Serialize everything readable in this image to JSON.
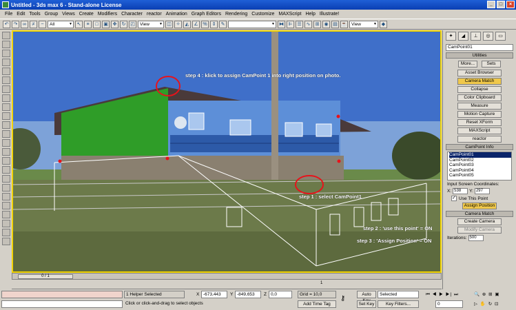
{
  "window": {
    "title": "Untitled - 3ds max 6 - Stand-alone License"
  },
  "menu": [
    "File",
    "Edit",
    "Tools",
    "Group",
    "Views",
    "Create",
    "Modifiers",
    "Character",
    "reactor",
    "Animation",
    "Graph Editors",
    "Rendering",
    "Customize",
    "MAXScript",
    "Help",
    "Illustrate!"
  ],
  "toolbar": {
    "selection_filter": "All",
    "ref_coord": "View",
    "named_selection": "",
    "view_dropdown": "View"
  },
  "viewport": {
    "annotations": {
      "step4": "step 4 : klick to assign CamPoint 1 into right position on photo.",
      "step1": "step 1 : select CamPoint1",
      "step2": "step 2 : 'use this point' = ON",
      "step3": "step 3 : 'Assign Position' = ON"
    },
    "highlight_color": "#e8121a",
    "viewport_border_color": "#f2d400"
  },
  "right_panel": {
    "object_name": "CamPoint01",
    "utilities": {
      "title": "Utilities",
      "more": "More...",
      "sets": "Sets",
      "buttons": [
        "Asset Browser",
        "Camera Match",
        "Collapse",
        "Color Clipboard",
        "Measure",
        "Motion Capture",
        "Reset XForm",
        "MAXScript",
        "reactor"
      ],
      "active_button": "Camera Match"
    },
    "campoint_info": {
      "title": "CamPoint Info",
      "points": [
        "CamPoint01",
        "CamPoint02",
        "CamPoint03",
        "CamPoint04",
        "CamPoint05"
      ],
      "selected": "CamPoint01",
      "coords_label": "Input Screen Coordinates:",
      "x_label": "X:",
      "x_value": "538",
      "y_label": "Y:",
      "y_value": "297",
      "use_this_point": "Use This Point",
      "use_this_point_checked": "✓",
      "assign_position": "Assign Position"
    },
    "camera_match": {
      "title": "Camera Match",
      "create_camera": "Create Camera",
      "modify_camera": "Modify Camera",
      "iterations_label": "Iterations:",
      "iterations_value": "500"
    }
  },
  "timeline": {
    "frame_label": "0 / 1",
    "end_mark": "1"
  },
  "status": {
    "selected": "1 Helper Selected",
    "prompt": "Click or click-and-drag to select objects",
    "x_label": "X",
    "x_value": "-673,443",
    "y_label": "Y",
    "y_value": "-849,653",
    "z_label": "Z",
    "z_value": "0,0",
    "grid": "Grid = 10,0",
    "add_time_tag": "Add Time Tag",
    "auto_key": "Auto Key",
    "selected_dropdown": "Selected",
    "set_key": "Set Key",
    "key_filters": "Key Filters...",
    "frame": "0"
  }
}
